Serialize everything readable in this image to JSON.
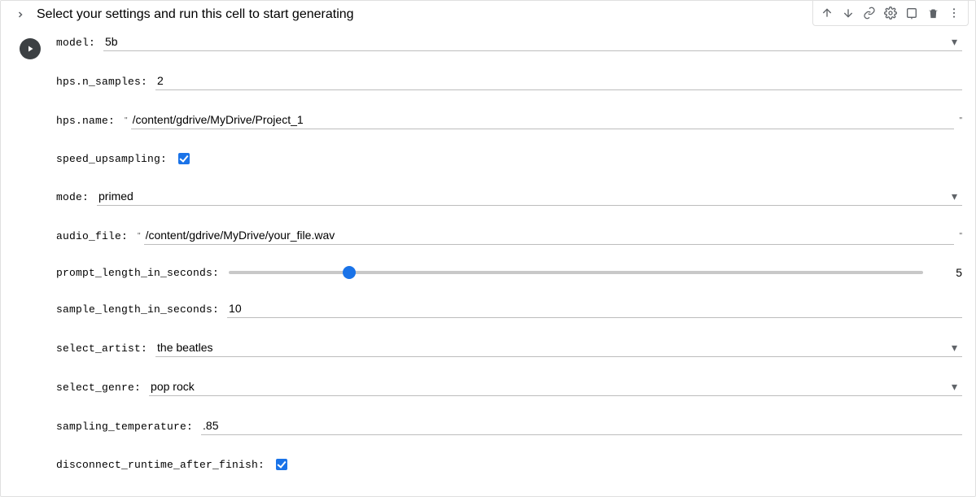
{
  "cell": {
    "title": "Select your settings and run this cell to start generating"
  },
  "form": {
    "model": {
      "label": "model:",
      "value": "5b"
    },
    "n_samples": {
      "label": "hps.n_samples:",
      "value": "2"
    },
    "name": {
      "label": "hps.name:",
      "value": "/content/gdrive/MyDrive/Project_1"
    },
    "speed_upsampling": {
      "label": "speed_upsampling:",
      "checked": true
    },
    "mode": {
      "label": "mode:",
      "value": "primed"
    },
    "audio_file": {
      "label": "audio_file:",
      "value": "/content/gdrive/MyDrive/your_file.wav"
    },
    "prompt_length": {
      "label": "prompt_length_in_seconds:",
      "value": 5,
      "min": 0,
      "max": 30
    },
    "sample_length": {
      "label": "sample_length_in_seconds:",
      "value": "10"
    },
    "select_artist": {
      "label": "select_artist:",
      "value": "the beatles"
    },
    "select_genre": {
      "label": "select_genre:",
      "value": "pop rock"
    },
    "sampling_temperature": {
      "label": "sampling_temperature:",
      "value": ".85"
    },
    "disconnect": {
      "label": "disconnect_runtime_after_finish:",
      "checked": true
    }
  },
  "quote": "\""
}
